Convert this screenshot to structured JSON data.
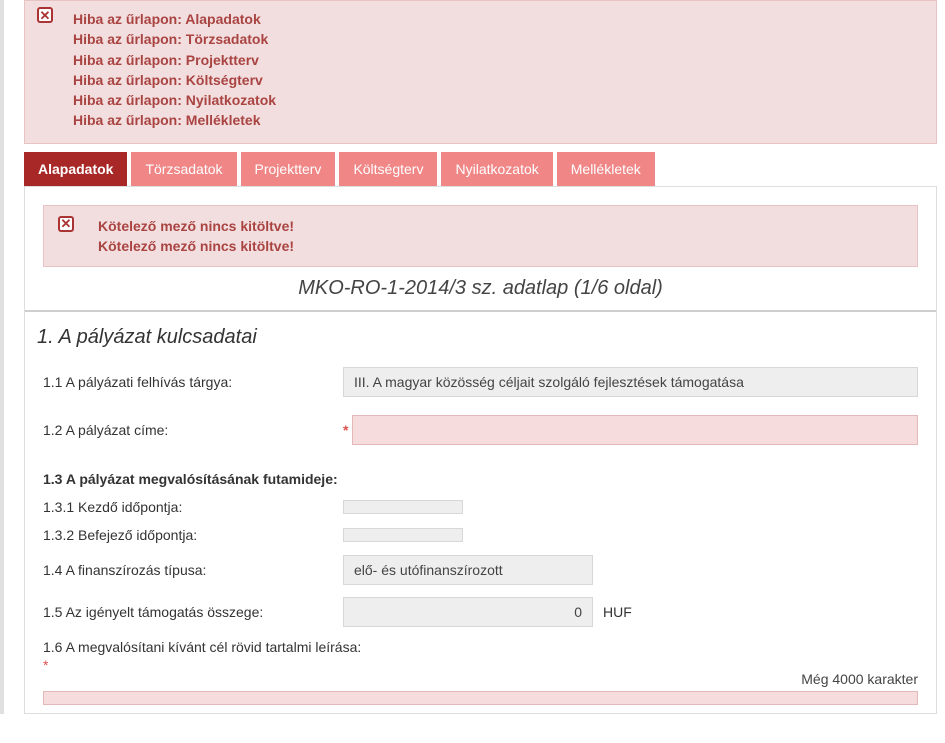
{
  "errors": {
    "lines": [
      "Hiba az űrlapon: Alapadatok",
      "Hiba az űrlapon: Törzsadatok",
      "Hiba az űrlapon: Projektterv",
      "Hiba az űrlapon: Költségterv",
      "Hiba az űrlapon: Nyilatkozatok",
      "Hiba az űrlapon: Mellékletek"
    ]
  },
  "tabs": [
    {
      "label": "Alapadatok",
      "active": true
    },
    {
      "label": "Törzsadatok",
      "active": false
    },
    {
      "label": "Projektterv",
      "active": false
    },
    {
      "label": "Költségterv",
      "active": false
    },
    {
      "label": "Nyilatkozatok",
      "active": false
    },
    {
      "label": "Mellékletek",
      "active": false
    }
  ],
  "inner_errors": [
    "Kötelező mező nincs kitöltve!",
    "Kötelező mező nincs kitöltve!"
  ],
  "page_title": "MKO-RO-1-2014/3 sz. adatlap (1/6 oldal)",
  "section_title": "1. A pályázat kulcsadatai",
  "fields": {
    "f11": {
      "label": "1.1 A pályázati felhívás tárgya:",
      "value": "III. A magyar közösség céljait szolgáló fejlesztések támogatása"
    },
    "f12": {
      "label": "1.2 A pályázat címe:",
      "value": ""
    },
    "f13": {
      "label": "1.3 A pályázat megvalósításának futamideje:"
    },
    "f131": {
      "label": "1.3.1 Kezdő időpontja:",
      "value": ""
    },
    "f132": {
      "label": "1.3.2 Befejező időpontja:",
      "value": ""
    },
    "f14": {
      "label": "1.4 A finanszírozás típusa:",
      "value": "elő- és utófinanszírozott"
    },
    "f15": {
      "label": "1.5 Az igényelt támogatás összege:",
      "value": "0",
      "currency": "HUF"
    },
    "f16": {
      "label": "1.6 A megvalósítani kívánt cél rövid tartalmi leírása:"
    }
  },
  "counter": "Még 4000 karakter"
}
